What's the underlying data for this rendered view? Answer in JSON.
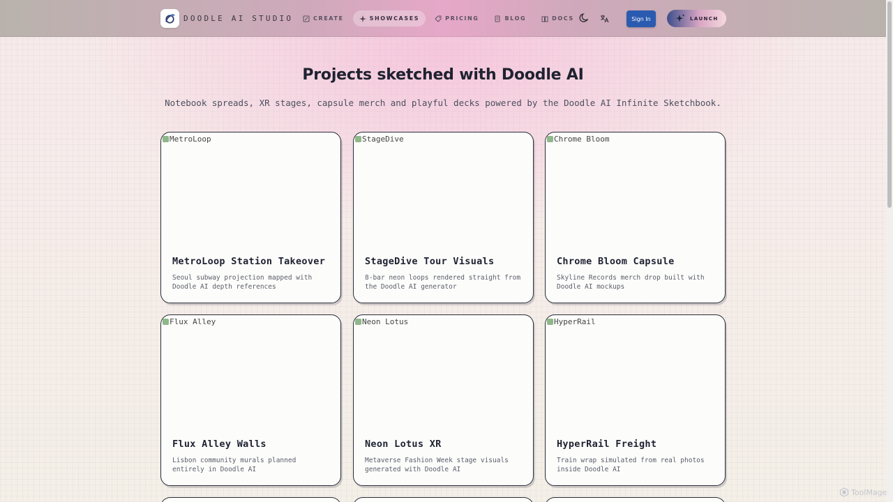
{
  "header": {
    "brand": "DOODLE AI STUDIO",
    "nav": [
      {
        "label": "CREATE",
        "icon": "pencil-icon",
        "active": false
      },
      {
        "label": "SHOWCASES",
        "icon": "sparkle-icon",
        "active": true
      },
      {
        "label": "PRICING",
        "icon": "tag-icon",
        "active": false
      },
      {
        "label": "BLOG",
        "icon": "document-icon",
        "active": false
      },
      {
        "label": "DOCS",
        "icon": "book-icon",
        "active": false
      }
    ],
    "signin_label": "Sign In",
    "launch_label": "LAUNCH"
  },
  "hero": {
    "title": "Projects sketched with Doodle AI",
    "subtitle": "Notebook spreads, XR stages, capsule merch and playful decks powered by the Doodle AI Infinite Sketchbook."
  },
  "cards": [
    {
      "alt": "MetroLoop",
      "title": "MetroLoop Station Takeover",
      "desc": "Seoul subway projection mapped with Doodle AI depth references"
    },
    {
      "alt": "StageDive",
      "title": "StageDive Tour Visuals",
      "desc": "8-bar neon loops rendered straight from the Doodle AI generator"
    },
    {
      "alt": "Chrome Bloom",
      "title": "Chrome Bloom Capsule",
      "desc": "Skyline Records merch drop built with Doodle AI mockups"
    },
    {
      "alt": "Flux Alley",
      "title": "Flux Alley Walls",
      "desc": "Lisbon community murals planned entirely in Doodle AI"
    },
    {
      "alt": "Neon Lotus",
      "title": "Neon Lotus XR",
      "desc": "Metaverse Fashion Week stage visuals generated with Doodle AI"
    },
    {
      "alt": "HyperRail",
      "title": "HyperRail Freight",
      "desc": "Train wrap simulated from real photos inside Doodle AI"
    }
  ],
  "watermark": "ToolMage",
  "colors": {
    "primary": "#2b5bb0",
    "border": "#2a2d38",
    "accent_pink": "#e6a8c8"
  }
}
